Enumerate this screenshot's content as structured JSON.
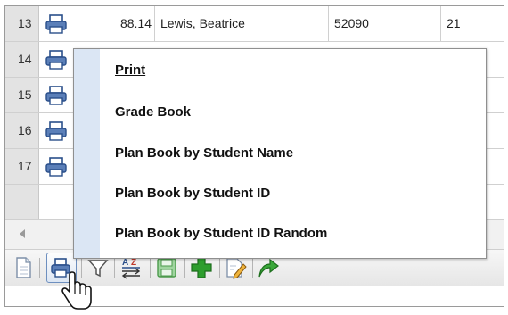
{
  "grid": {
    "rows": [
      {
        "num": "13",
        "score": "88.14",
        "name": "Lewis, Beatrice",
        "id": "52090",
        "extra": "21"
      },
      {
        "num": "14"
      },
      {
        "num": "15"
      },
      {
        "num": "16"
      },
      {
        "num": "17"
      }
    ]
  },
  "print_menu": {
    "items": [
      {
        "label": "Print"
      },
      {
        "label": "Grade Book"
      },
      {
        "label": "Plan Book by Student Name"
      },
      {
        "label": "Plan Book by Student ID"
      },
      {
        "label": "Plan Book by Student ID Random"
      }
    ]
  },
  "toolbar": {
    "buttons": [
      {
        "icon": "new-page-icon"
      },
      {
        "icon": "printer-icon"
      },
      {
        "icon": "filter-icon"
      },
      {
        "icon": "sort-az-icon"
      },
      {
        "icon": "save-icon"
      },
      {
        "icon": "add-icon"
      },
      {
        "icon": "edit-icon"
      },
      {
        "icon": "forward-arrow-icon"
      }
    ]
  },
  "colors": {
    "accent_green": "#2e9e2e",
    "menu_gutter": "#dbe6f4",
    "row_header": "#e3e3e3"
  }
}
